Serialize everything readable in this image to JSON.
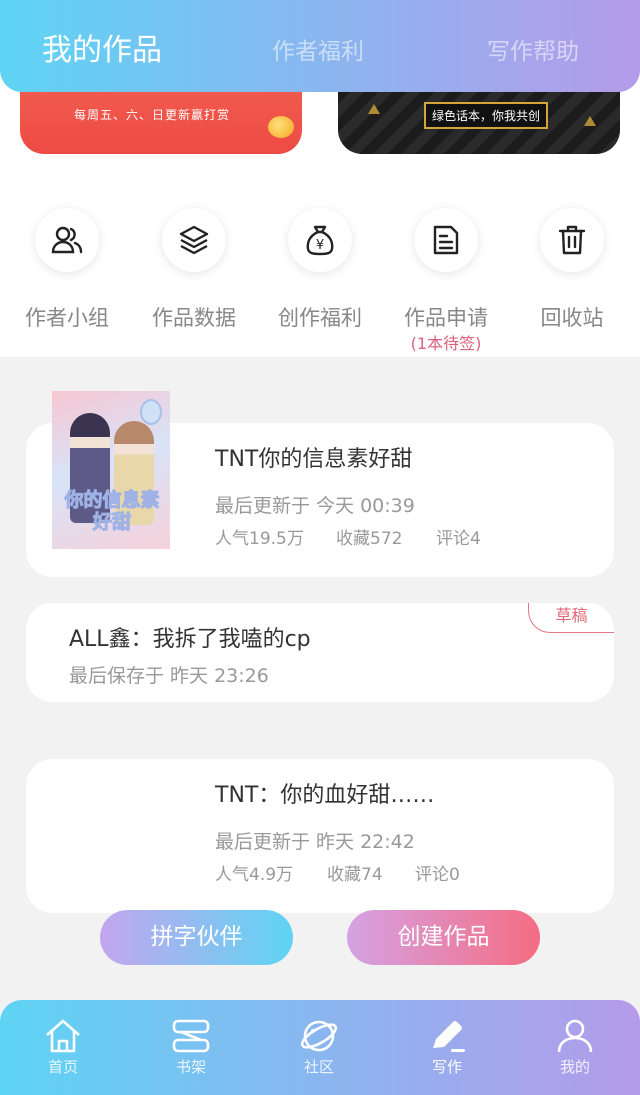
{
  "header": {
    "tabs": [
      {
        "label": "我的作品",
        "active": true
      },
      {
        "label": "作者福利",
        "active": false
      },
      {
        "label": "写作帮助",
        "active": false
      }
    ]
  },
  "banners": {
    "red_text": "每周五、六、日更新赢打赏",
    "dark_text": "绿色话本，你我共创"
  },
  "quick_actions": [
    {
      "label": "作者小组",
      "icon": "users-icon"
    },
    {
      "label": "作品数据",
      "icon": "layers-icon"
    },
    {
      "label": "创作福利",
      "icon": "money-bag-icon"
    },
    {
      "label": "作品申请",
      "sub": "(1本待签)",
      "icon": "document-icon"
    },
    {
      "label": "回收站",
      "icon": "trash-icon"
    }
  ],
  "works": [
    {
      "title": "TNT你的信息素好甜",
      "meta": "最后更新于 今天 00:39",
      "stats": [
        "人气19.5万",
        "收藏572",
        "评论4"
      ],
      "cover_title": "你的信息素好甜"
    },
    {
      "title": "ALL鑫：我拆了我嗑的cp",
      "meta": "最后保存于 昨天 23:26",
      "tag": "草稿"
    },
    {
      "title": "TNT：你的血好甜……",
      "meta": "最后更新于 昨天 22:42",
      "stats": [
        "人气4.9万",
        "收藏74",
        "评论0"
      ]
    }
  ],
  "buttons": {
    "partner": "拼字伙伴",
    "create": "创建作品"
  },
  "bottom_nav": [
    {
      "label": "首页",
      "icon": "home-icon"
    },
    {
      "label": "书架",
      "icon": "bookshelf-icon"
    },
    {
      "label": "社区",
      "icon": "planet-icon"
    },
    {
      "label": "写作",
      "icon": "pen-icon",
      "active": true
    },
    {
      "label": "我的",
      "icon": "user-icon"
    }
  ],
  "colors": {
    "gradient_start": "#5ed4f4",
    "gradient_end": "#b59bea",
    "draft_tag": "#e06a78",
    "pending_sub": "#e0607a"
  }
}
